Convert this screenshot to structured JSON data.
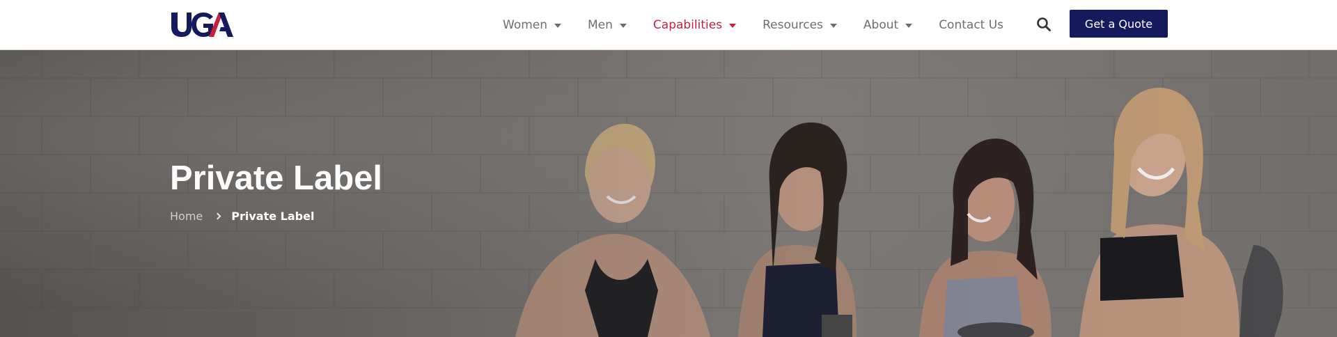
{
  "brand": {
    "logo_text": "UGA",
    "primary_color": "#151a5c",
    "accent_color": "#c8203f"
  },
  "nav": {
    "items": [
      {
        "label": "Women"
      },
      {
        "label": "Men"
      },
      {
        "label": "Capabilities"
      },
      {
        "label": "Resources"
      },
      {
        "label": "About"
      },
      {
        "label": "Contact Us"
      }
    ],
    "active": "Capabilities",
    "search_icon": "search-icon",
    "cta_label": "Get a Quote"
  },
  "hero": {
    "title": "Private Label",
    "breadcrumb": {
      "home": "Home",
      "current": "Private Label",
      "separator_icon": "chevron-right-icon"
    },
    "image": "four-women-in-sportswear-laughing"
  }
}
